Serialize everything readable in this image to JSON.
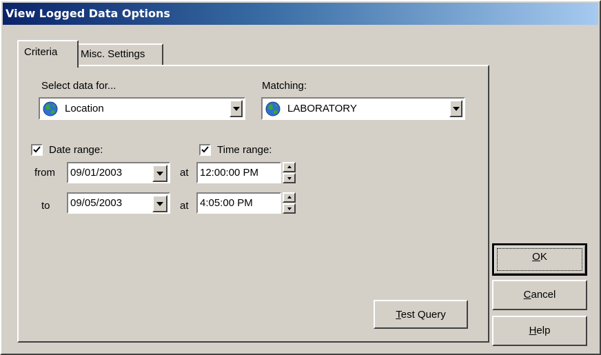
{
  "window": {
    "title": "View Logged Data Options"
  },
  "tabs": [
    {
      "label": "Criteria",
      "active": true
    },
    {
      "label": "Misc. Settings",
      "active": false
    }
  ],
  "criteria": {
    "select_label": "Select data for...",
    "select_value": "Location",
    "select_icon": "globe-icon",
    "matching_label": "Matching:",
    "matching_value": "LABORATORY",
    "matching_icon": "globe-icon",
    "date_range": {
      "label": "Date range:",
      "checked": true
    },
    "time_range": {
      "label": "Time range:",
      "checked": true
    },
    "from_label": "from",
    "to_label": "to",
    "at_label": "at",
    "from_date": "09/01/2003",
    "from_time": "12:00:00 PM",
    "to_date": "09/05/2003",
    "to_time": "4:05:00 PM"
  },
  "buttons": {
    "test_query": {
      "mnemonic": "T",
      "rest": "est Query"
    },
    "ok": {
      "mnemonic": "O",
      "rest": "K"
    },
    "cancel": {
      "mnemonic": "C",
      "rest": "ancel"
    },
    "help": {
      "mnemonic": "H",
      "rest": "elp"
    }
  },
  "colors": {
    "face": "#d4d0c8",
    "title_start": "#0a246a",
    "title_end": "#a6caf0"
  }
}
